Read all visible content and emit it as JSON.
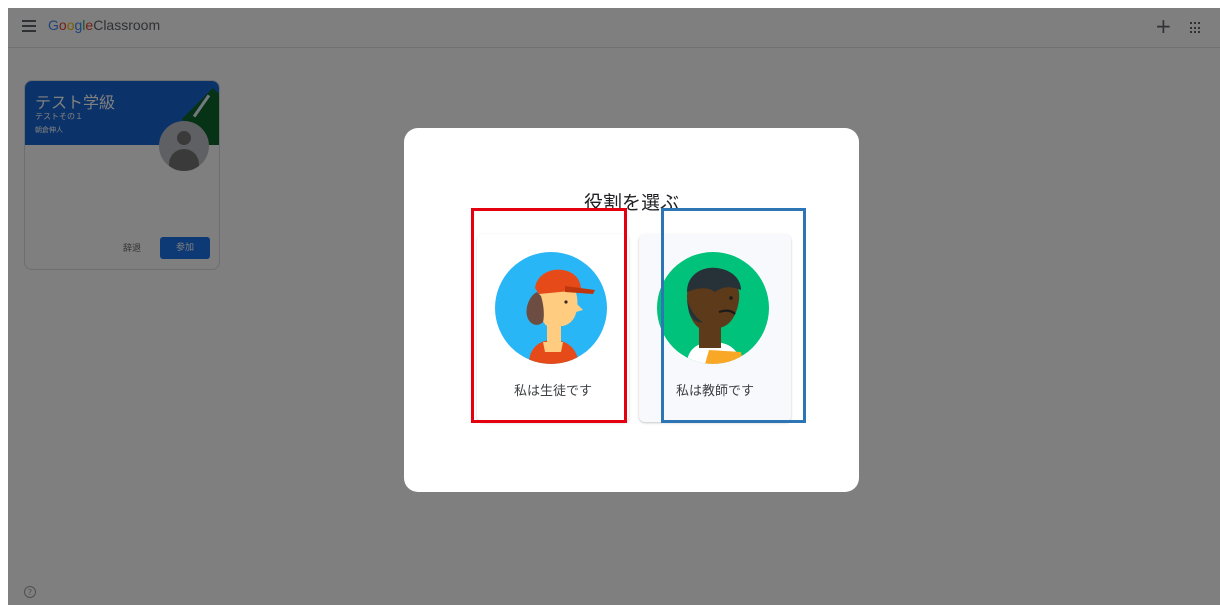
{
  "topbar": {
    "brand_google": [
      "G",
      "o",
      "o",
      "g",
      "l",
      "e"
    ],
    "brand_product": "Classroom",
    "add_label": "+"
  },
  "class_card": {
    "title": "テスト学級",
    "subtitle": "テストその１",
    "teacher": "朝倉伸人",
    "decline_label": "辞退",
    "join_label": "参加"
  },
  "help": {
    "label": "?"
  },
  "dialog": {
    "title": "役割を選ぶ",
    "student_label": "私は生徒です",
    "teacher_label": "私は教師です"
  },
  "colors": {
    "annotation_red": "#e4000f",
    "annotation_blue": "#2e75b6",
    "primary": "#1a73e8"
  },
  "icons": [
    "menu-icon",
    "plus-icon",
    "apps-grid-icon",
    "help-icon",
    "student-avatar-icon",
    "teacher-avatar-icon"
  ]
}
